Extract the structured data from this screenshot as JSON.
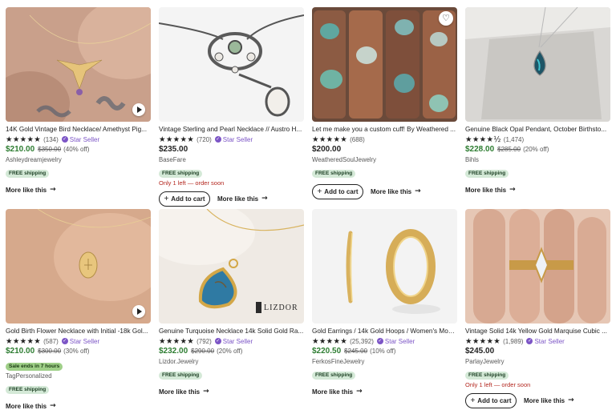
{
  "labels": {
    "star_seller": "Star Seller",
    "add_to_cart": "Add to cart",
    "more_like_this": "More like this",
    "plus_icon": "+",
    "arrow_icon": "→"
  },
  "products": [
    {
      "title": "14K Gold Vintage Bird Necklace/ Amethyst Pig...",
      "stars": "★★★★★",
      "count": "(134)",
      "price": "$210.00",
      "original": "$350.00",
      "discount": "(40% off)",
      "shop": "Ashleydreamjewelry",
      "badge": "FREE shipping",
      "stock": ""
    },
    {
      "title": "Vintage Sterling and Pearl Necklace // Austro H...",
      "stars": "★★★★★",
      "count": "(720)",
      "price": "$235.00",
      "original": "",
      "discount": "",
      "shop": "BaseFare",
      "badge": "FREE shipping",
      "stock": "Only 1 left — order soon"
    },
    {
      "title": "Let me make you a custom cuff! By Weathered ...",
      "stars": "★★★★★",
      "count": "(688)",
      "price": "$200.00",
      "original": "",
      "discount": "",
      "shop": "WeatheredSoulJewelry",
      "badge": "FREE shipping",
      "stock": ""
    },
    {
      "title": "Genuine Black Opal Pendant, October Birthsto...",
      "stars": "★★★★½",
      "count": "(1,474)",
      "price": "$228.00",
      "original": "$285.00",
      "discount": "(20% off)",
      "shop": "Bihls",
      "badge": "FREE shipping",
      "stock": ""
    },
    {
      "title": "Gold Birth Flower Necklace with Initial -18k Gol...",
      "stars": "★★★★★",
      "count": "(587)",
      "price": "$210.00",
      "original": "$300.00",
      "discount": "(30% off)",
      "shop": "TagPersonalized",
      "sale_ends": "Sale ends in 7 hours",
      "badge": "FREE shipping",
      "stock": ""
    },
    {
      "title": "Genuine Turquoise Necklace 14k Solid Gold Ra...",
      "stars": "★★★★★",
      "count": "(792)",
      "price": "$232.00",
      "original": "$290.00",
      "discount": "(20% off)",
      "shop": "Lizdor.Jewelry",
      "badge": "FREE shipping",
      "stock": "",
      "watermark": "LIZDOR"
    },
    {
      "title": "Gold Earrings / 14k Gold Hoops / Women's Mod...",
      "stars": "★★★★★",
      "count": "(25,392)",
      "price": "$220.50",
      "original": "$245.00",
      "discount": "(10% off)",
      "shop": "FerkosFineJewelry",
      "badge": "FREE shipping",
      "stock": ""
    },
    {
      "title": "Vintage Solid 14k Yellow Gold Marquise Cubic ...",
      "stars": "★★★★★",
      "count": "(1,989)",
      "price": "$245.00",
      "original": "",
      "discount": "",
      "shop": "ParlayJewelry",
      "badge": "FREE shipping",
      "stock": "Only 1 left — order soon"
    }
  ]
}
